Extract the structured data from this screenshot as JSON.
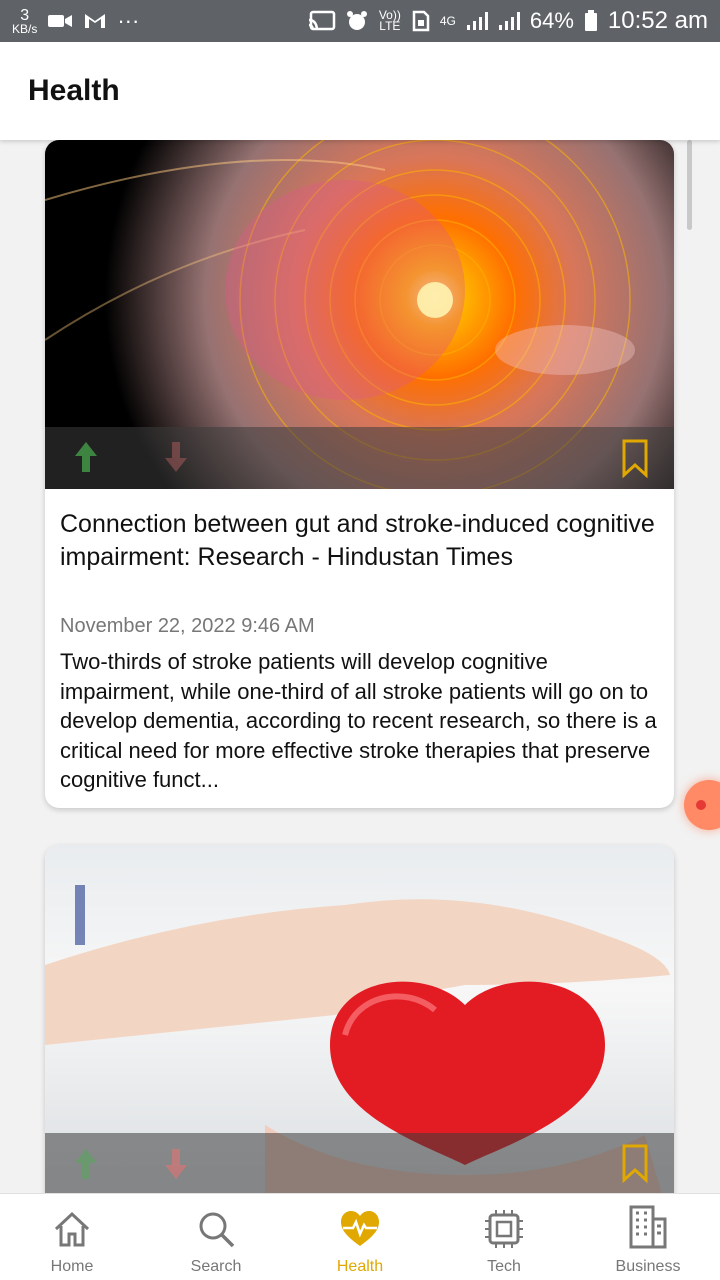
{
  "status_bar": {
    "net_speed_value": "3",
    "net_speed_unit": "KB/s",
    "more": "···",
    "volte_label": "Vo)) LTE",
    "network": "4G",
    "battery": "64%",
    "time": "10:52 am"
  },
  "app_bar": {
    "title": "Health"
  },
  "articles": [
    {
      "title": "Connection between gut and stroke-induced cognitive impairment: Research - Hindustan Times",
      "date": "November 22, 2022 9:46 AM",
      "description": "Two-thirds of stroke patients will develop cognitive impairment, while one-third of all stroke patients will go on to develop dementia, according to recent research, so there is a critical need for more effective stroke therapies that preserve cognitive funct...",
      "image_icon": "brain-scan-image"
    },
    {
      "image_icon": "heart-in-hands-image"
    }
  ],
  "bottom_nav": [
    {
      "label": "Home",
      "icon": "home-icon",
      "active": false
    },
    {
      "label": "Search",
      "icon": "search-icon",
      "active": false
    },
    {
      "label": "Health",
      "icon": "heartbeat-icon",
      "active": true
    },
    {
      "label": "Tech",
      "icon": "chip-icon",
      "active": false
    },
    {
      "label": "Business",
      "icon": "building-icon",
      "active": false
    }
  ],
  "colors": {
    "accent": "#e0a800",
    "upvote": "#4caf50",
    "downvote": "#e57373",
    "status_bar": "#5f6368"
  }
}
